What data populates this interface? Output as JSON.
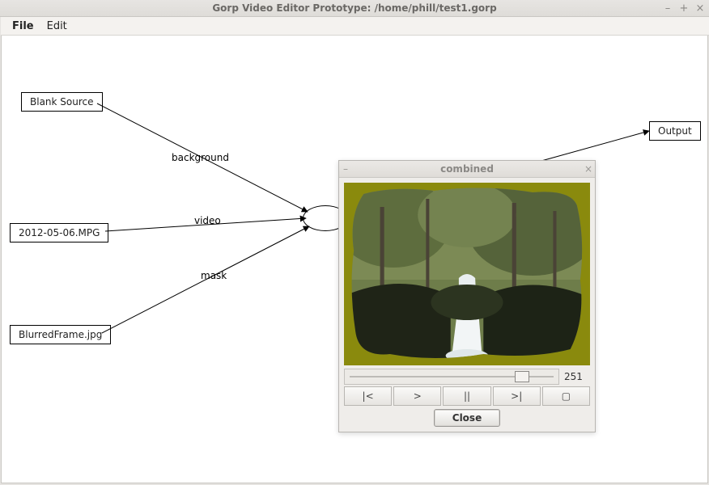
{
  "window": {
    "title": "Gorp Video Editor Prototype: /home/phill/test1.gorp",
    "controls": {
      "minimize": "–",
      "maximize": "+",
      "close": "×"
    }
  },
  "menubar": {
    "items": [
      "File",
      "Edit"
    ]
  },
  "graph": {
    "nodes": {
      "blank_source": "Blank Source",
      "clip1": "2012-05-06.MPG",
      "blurred": "BlurredFrame.jpg",
      "output": "Output"
    },
    "edge_labels": {
      "background": "background",
      "video": "video",
      "mask": "mask"
    }
  },
  "preview": {
    "title": "combined",
    "controls": {
      "minimize": "–",
      "close": "×"
    },
    "slider_value": "251",
    "transport": {
      "to_start": "|<",
      "play": ">",
      "pause": "||",
      "to_end": ">|",
      "stop": "▢"
    },
    "close_label": "Close"
  }
}
